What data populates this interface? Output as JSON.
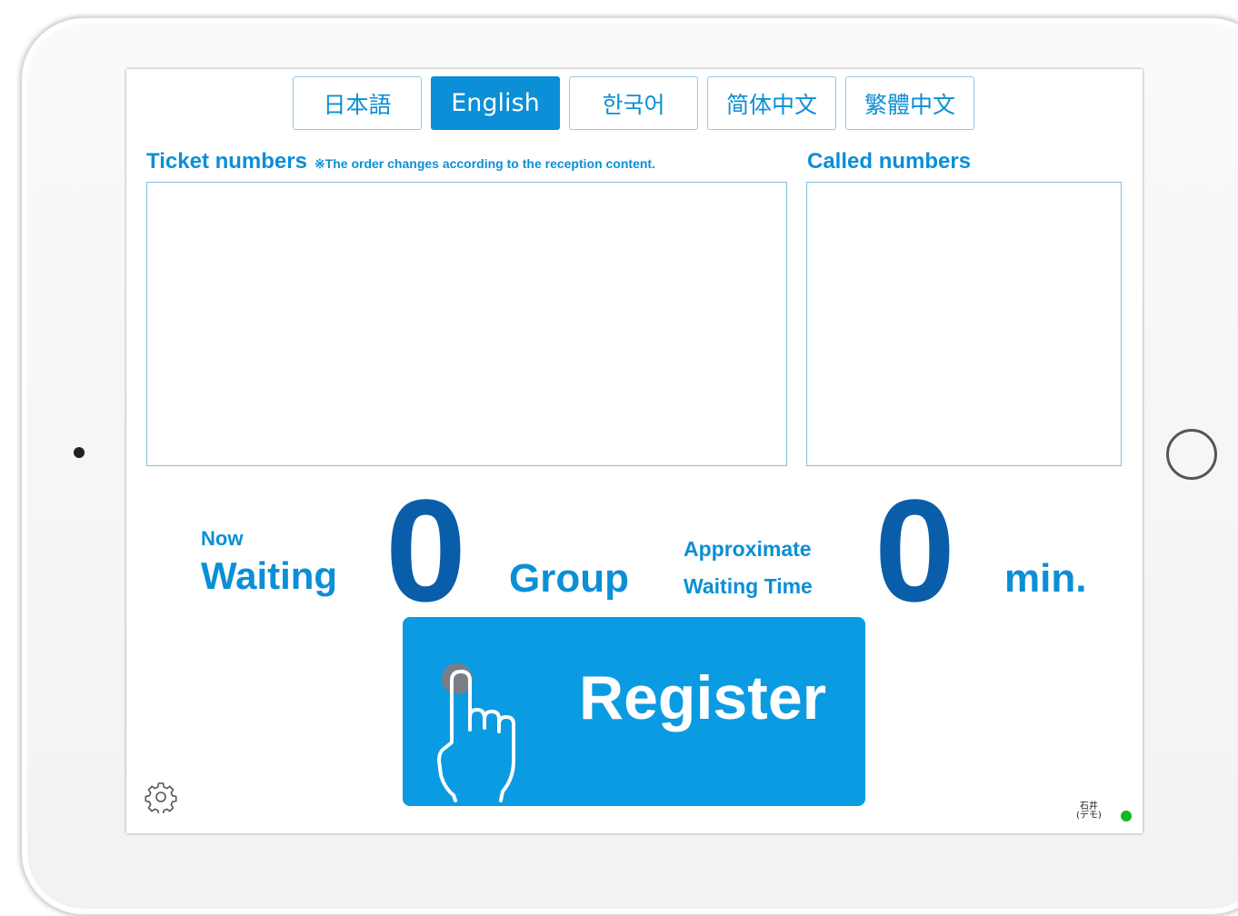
{
  "languages": [
    {
      "label": "日本語"
    },
    {
      "label": "English"
    },
    {
      "label": "한국어"
    },
    {
      "label": "简体中文"
    },
    {
      "label": "繁體中文"
    }
  ],
  "active_language": "English",
  "ticket_panel": {
    "title": "Ticket numbers",
    "note": "※The order changes according to the reception content."
  },
  "called_panel": {
    "title": "Called numbers"
  },
  "waiting": {
    "prefix": "Now",
    "label": "Waiting",
    "count": "0",
    "unit": "Group"
  },
  "wait_time": {
    "line1": "Approximate",
    "line2": "Waiting Time",
    "value": "0",
    "unit": "min."
  },
  "register": {
    "label": "Register"
  },
  "device": {
    "name_line1": "石井",
    "name_line2": "(デモ)"
  },
  "colors": {
    "accent": "#0b8fd6",
    "number": "#0a5ea9",
    "register_bg": "#0b9be3",
    "status_online": "#11b822"
  },
  "icons": {
    "settings": "gear-icon",
    "register": "hand-tap-icon"
  }
}
